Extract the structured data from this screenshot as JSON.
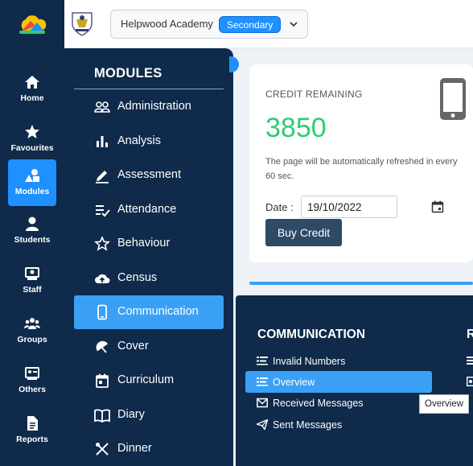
{
  "rail": {
    "items": [
      {
        "label": "Home",
        "icon": "home-icon"
      },
      {
        "label": "Favourites",
        "icon": "star-icon"
      },
      {
        "label": "Modules",
        "icon": "shapes-icon",
        "active": true
      },
      {
        "label": "Students",
        "icon": "person-icon"
      },
      {
        "label": "Staff",
        "icon": "staff-icon"
      },
      {
        "label": "Groups",
        "icon": "group-icon"
      },
      {
        "label": "Others",
        "icon": "others-icon"
      },
      {
        "label": "Reports",
        "icon": "report-icon"
      }
    ]
  },
  "header": {
    "school_name": "Helpwood Academy",
    "school_badge": "Secondary"
  },
  "modules": {
    "title": "MODULES",
    "items": [
      {
        "label": "Administration",
        "icon": "people-icon"
      },
      {
        "label": "Analysis",
        "icon": "bar-chart-icon"
      },
      {
        "label": "Assessment",
        "icon": "pencil-icon"
      },
      {
        "label": "Attendance",
        "icon": "checklist-icon"
      },
      {
        "label": "Behaviour",
        "icon": "star-outline-icon"
      },
      {
        "label": "Census",
        "icon": "cloud-upload-icon"
      },
      {
        "label": "Communication",
        "icon": "phone-icon",
        "active": true
      },
      {
        "label": "Cover",
        "icon": "umbrella-icon"
      },
      {
        "label": "Curriculum",
        "icon": "calendar-icon"
      },
      {
        "label": "Diary",
        "icon": "book-icon"
      },
      {
        "label": "Dinner",
        "icon": "cutlery-icon"
      }
    ]
  },
  "credit": {
    "caption": "CREDIT REMAINING",
    "value": "3850",
    "note": "The page will be automatically refreshed in every 60 sec.",
    "date_label": "Date :",
    "date_value": "19/10/2022",
    "buy_label": "Buy Credit"
  },
  "communication": {
    "title": "COMMUNICATION",
    "right_title": "R",
    "items": [
      {
        "label": "Invalid Numbers",
        "icon": "list-icon"
      },
      {
        "label": "Overview",
        "icon": "list-icon",
        "active": true
      },
      {
        "label": "Received Messages",
        "icon": "envelope-icon"
      },
      {
        "label": "Sent Messages",
        "icon": "send-icon"
      }
    ]
  },
  "tooltip": "Overview",
  "colors": {
    "navy": "#0f2a4a",
    "accent": "#1e90ff",
    "active": "#3aa0f5",
    "credit_green": "#2ecc71"
  }
}
